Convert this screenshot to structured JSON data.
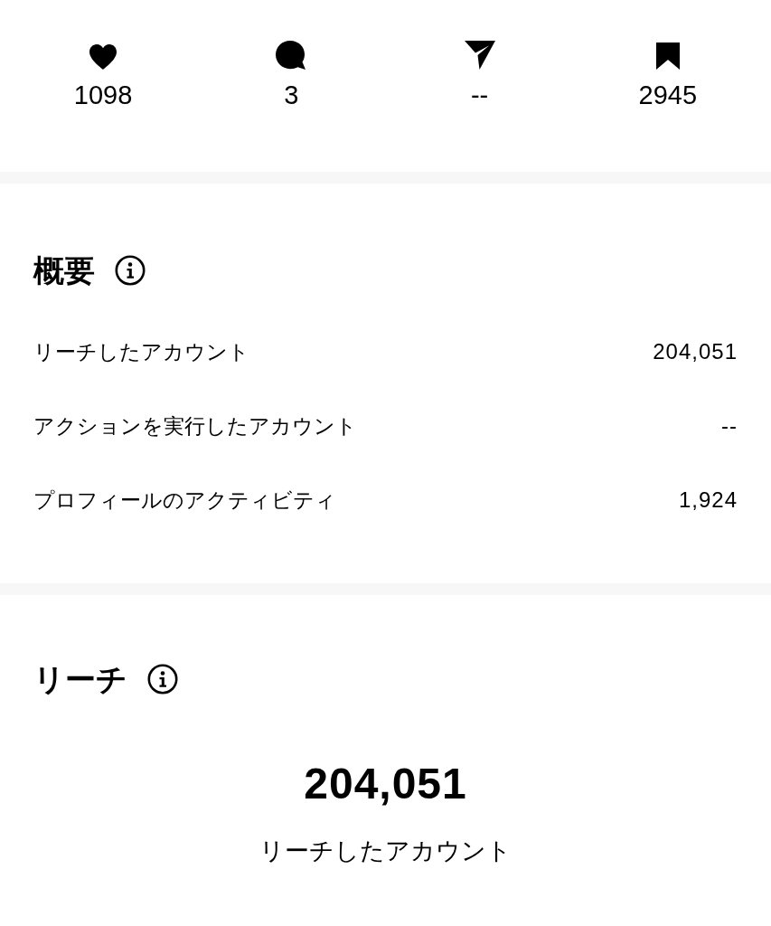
{
  "stats": [
    {
      "kind": "likes",
      "count": "1098"
    },
    {
      "kind": "comments",
      "count": "3"
    },
    {
      "kind": "shares",
      "count": "--"
    },
    {
      "kind": "saves",
      "count": "2945"
    }
  ],
  "overview": {
    "title": "概要",
    "rows": [
      {
        "label": "リーチしたアカウント",
        "value": "204,051"
      },
      {
        "label": "アクションを実行したアカウント",
        "value": "--"
      },
      {
        "label": "プロフィールのアクティビティ",
        "value": "1,924"
      }
    ]
  },
  "reach": {
    "title": "リーチ",
    "total": "204,051",
    "caption": "リーチしたアカウント"
  }
}
